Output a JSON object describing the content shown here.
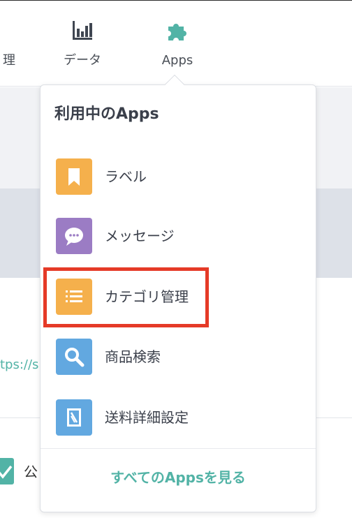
{
  "nav": {
    "items": [
      {
        "label": "理"
      },
      {
        "label": "データ",
        "icon": "bar-chart-icon"
      },
      {
        "label": "Apps",
        "icon": "puzzle-icon"
      }
    ]
  },
  "background": {
    "link_partial": "tps://s",
    "public_partial": "公"
  },
  "apps_menu": {
    "title": "利用中のApps",
    "items": [
      {
        "label": "ラベル",
        "icon": "bookmark-icon",
        "color": "#f5b04c"
      },
      {
        "label": "メッセージ",
        "icon": "chat-bubble-icon",
        "color": "#9b7cc4"
      },
      {
        "label": "カテゴリ管理",
        "icon": "list-icon",
        "color": "#f5b04c",
        "highlighted": true
      },
      {
        "label": "商品検索",
        "icon": "search-icon",
        "color": "#62a8e0"
      },
      {
        "label": "送料詳細設定",
        "icon": "stamp-icon",
        "color": "#62a8e0"
      }
    ],
    "footer_link": "すべてのAppsを見る"
  },
  "colors": {
    "accent": "#52b3a6",
    "highlight": "#e53a27",
    "text": "#3a3f4a"
  }
}
